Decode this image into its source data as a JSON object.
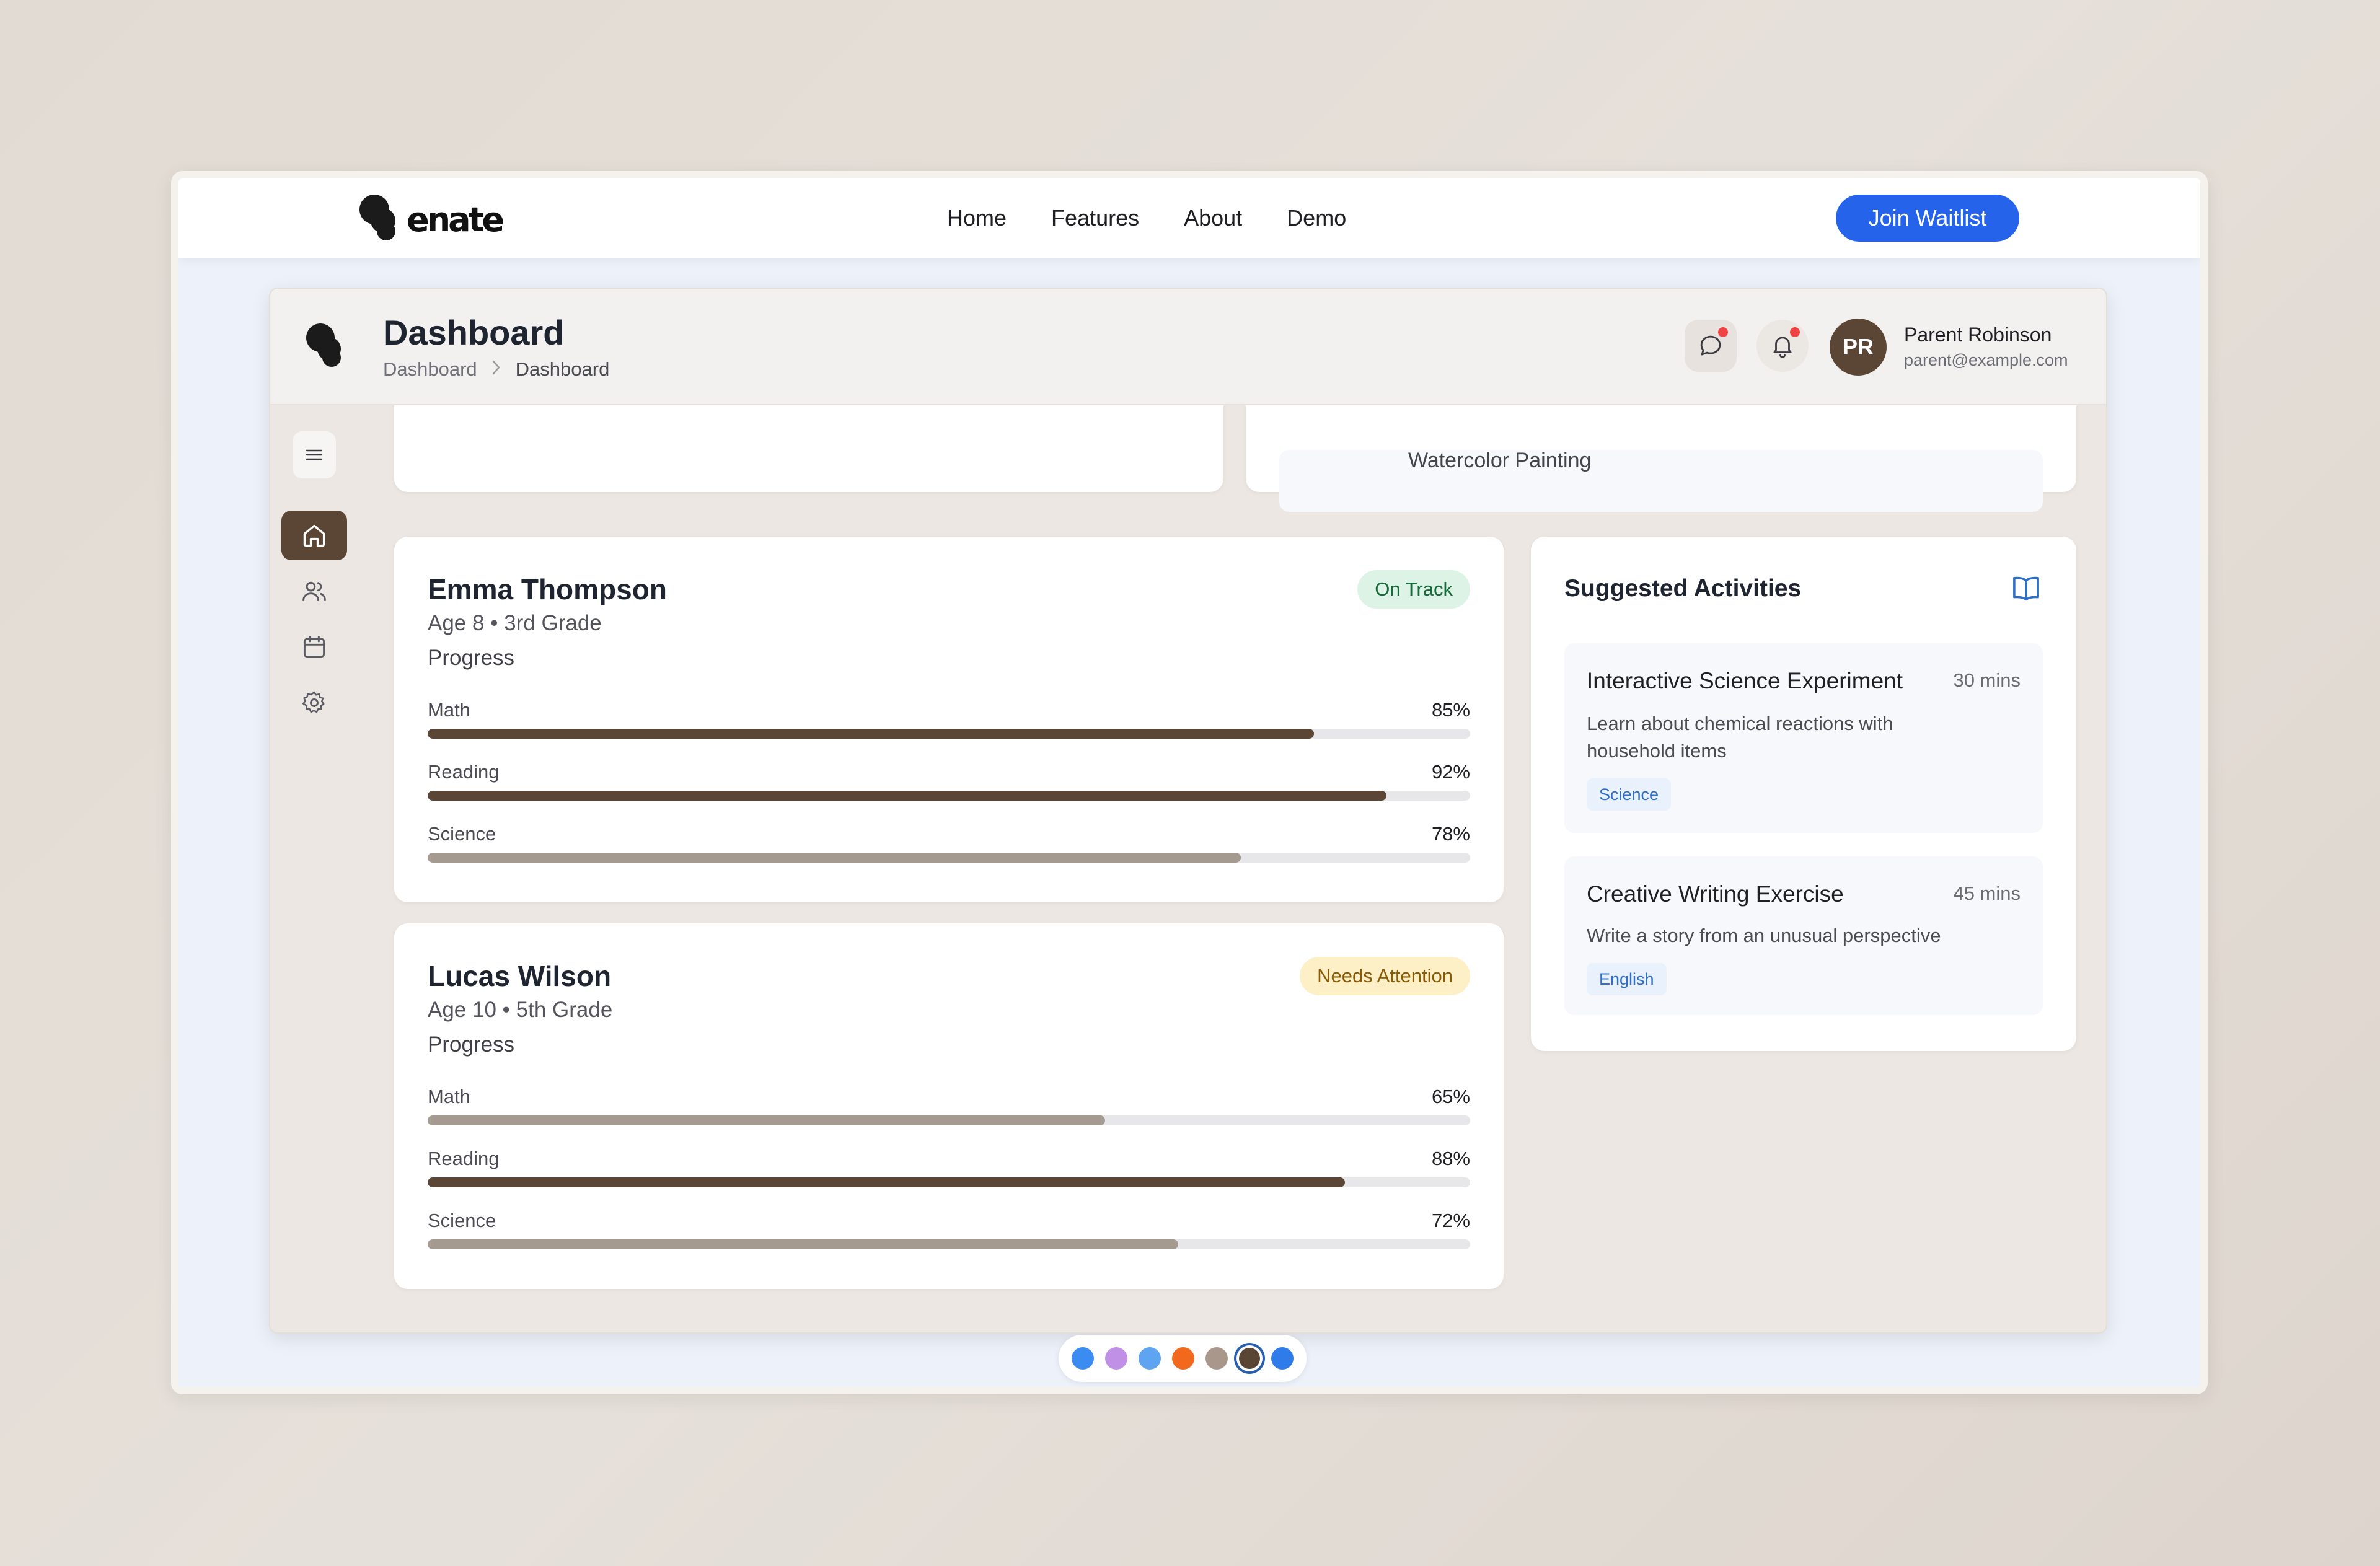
{
  "site": {
    "logo_text": "enate",
    "nav": [
      "Home",
      "Features",
      "About",
      "Demo"
    ],
    "cta": "Join Waitlist"
  },
  "header": {
    "title": "Dashboard",
    "breadcrumb": [
      "Dashboard",
      "Dashboard"
    ],
    "user": {
      "initials": "PR",
      "name": "Parent Robinson",
      "email": "parent@example.com"
    }
  },
  "sidebar": {
    "items": [
      "home-icon",
      "users-icon",
      "calendar-icon",
      "settings-icon"
    ],
    "active": "home"
  },
  "peek": {
    "activity": "Watercolor Painting"
  },
  "children": [
    {
      "name": "Emma Thompson",
      "meta": "Age 8 • 3rd Grade",
      "progress_label": "Progress",
      "status": "On Track",
      "subjects": [
        {
          "label": "Math",
          "pct": "85%",
          "value": 85
        },
        {
          "label": "Reading",
          "pct": "92%",
          "value": 92
        },
        {
          "label": "Science",
          "pct": "78%",
          "value": 78
        }
      ]
    },
    {
      "name": "Lucas Wilson",
      "meta": "Age 10 • 5th Grade",
      "progress_label": "Progress",
      "status": "Needs Attention",
      "subjects": [
        {
          "label": "Math",
          "pct": "65%",
          "value": 65
        },
        {
          "label": "Reading",
          "pct": "88%",
          "value": 88
        },
        {
          "label": "Science",
          "pct": "72%",
          "value": 72
        }
      ]
    }
  ],
  "suggested": {
    "title": "Suggested Activities",
    "activities": [
      {
        "title": "Interactive Science Experiment",
        "time": "30 mins",
        "desc": "Learn about chemical reactions with household items",
        "tag": "Science"
      },
      {
        "title": "Creative Writing Exercise",
        "time": "45 mins",
        "desc": "Write a story from an unusual perspective",
        "tag": "English"
      }
    ]
  },
  "theme_colors": [
    "#3b8cf0",
    "#c08fe6",
    "#5ea4f0",
    "#f2681c",
    "#a8978a",
    "#5b4636",
    "#2f7bea"
  ],
  "selected_theme": 5
}
